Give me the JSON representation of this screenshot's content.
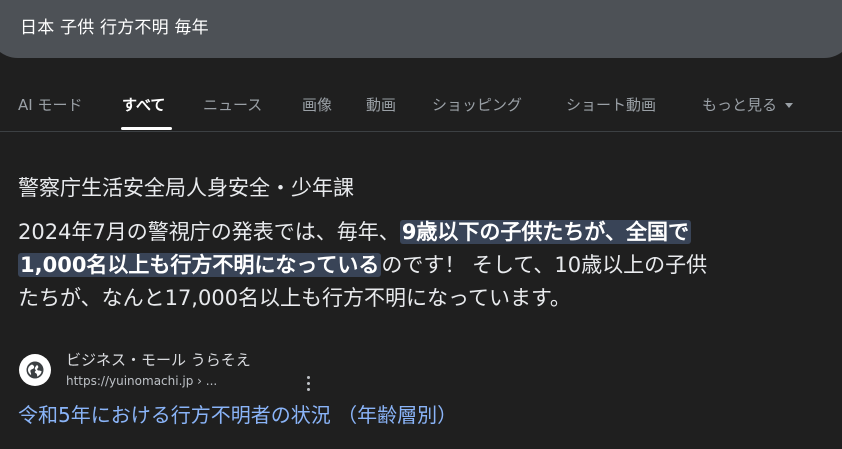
{
  "search": {
    "query": "日本 子供 行方不明 毎年"
  },
  "tabs": [
    {
      "label": "AI モード"
    },
    {
      "label": "すべて"
    },
    {
      "label": "ニュース"
    },
    {
      "label": "画像"
    },
    {
      "label": "動画"
    },
    {
      "label": "ショッピング"
    },
    {
      "label": "ショート動画"
    },
    {
      "label": "もっと見る"
    }
  ],
  "snippet": {
    "source_heading": "警察庁生活安全局人身安全・少年課",
    "line1_plain": "2024年7月の警視庁の発表では、毎年、",
    "line1_highlight": "9歳以下の子供たちが、全国で",
    "line2_highlight": "1,000名以上も行方不明になっている",
    "line2_plain": "のです！ そして、10歳以上の子供",
    "line3_plain": "たちが、なんと17,000名以上も行方不明になっています。"
  },
  "result": {
    "site_name": "ビジネス・モール うらそえ",
    "site_url": "https://yuinomachi.jp › ...",
    "title": "令和5年における行方不明者の状況 （年齢層別）"
  },
  "icons": {
    "favicon": "globe-icon",
    "menu": "more-vert-icon",
    "tab_more": "caret-down-icon"
  },
  "colors": {
    "background": "#1f1f1f",
    "search_bar": "#4d5156",
    "highlight": "#394457",
    "link": "#8ab4f8"
  }
}
